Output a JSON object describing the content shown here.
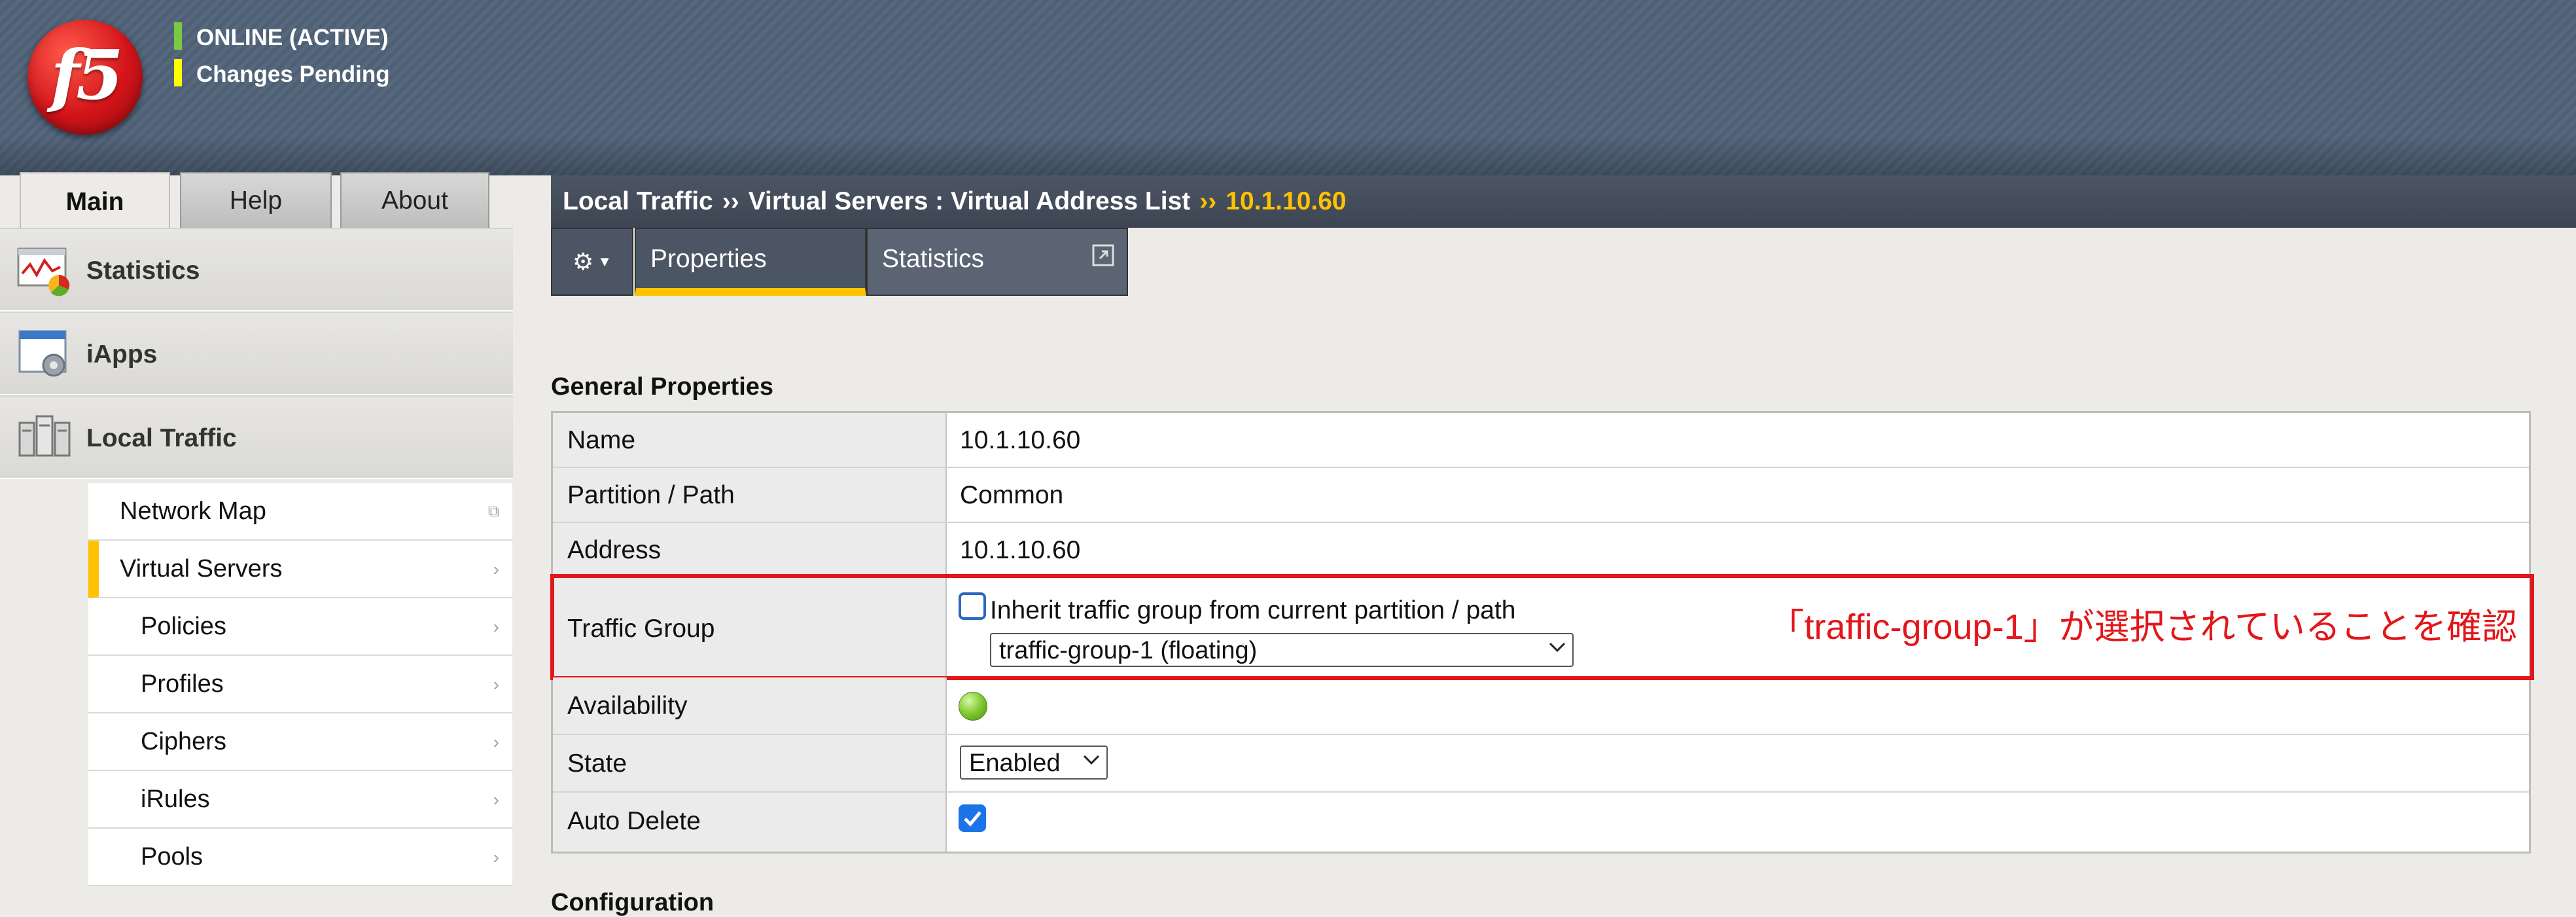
{
  "header": {
    "logo_text": "f5",
    "status_online": "ONLINE (ACTIVE)",
    "status_pending": "Changes Pending",
    "online_color": "#7ac943",
    "pending_color": "#ffff00"
  },
  "main_tabs": [
    {
      "label": "Main",
      "active": true
    },
    {
      "label": "Help",
      "active": false
    },
    {
      "label": "About",
      "active": false
    }
  ],
  "breadcrumb": {
    "part1": "Local Traffic",
    "sep": "››",
    "part2": "Virtual Servers : Virtual Address List",
    "current": "10.1.10.60"
  },
  "sidebar": {
    "sections": [
      {
        "label": "Statistics",
        "icon": "statistics-chart-icon"
      },
      {
        "label": "iApps",
        "icon": "iapps-gear-window-icon"
      },
      {
        "label": "Local Traffic",
        "icon": "local-traffic-servers-icon"
      }
    ],
    "items": [
      {
        "label": "Network Map",
        "selected": false,
        "indent": false
      },
      {
        "label": "Virtual Servers",
        "selected": true,
        "indent": false
      },
      {
        "label": "Policies",
        "selected": false,
        "indent": true
      },
      {
        "label": "Profiles",
        "selected": false,
        "indent": true
      },
      {
        "label": "Ciphers",
        "selected": false,
        "indent": true
      },
      {
        "label": "iRules",
        "selected": false,
        "indent": true
      },
      {
        "label": "Pools",
        "selected": false,
        "indent": true
      }
    ]
  },
  "subtabs": {
    "properties": "Properties",
    "statistics": "Statistics"
  },
  "general": {
    "title": "General Properties",
    "name_label": "Name",
    "name_value": "10.1.10.60",
    "partition_label": "Partition / Path",
    "partition_value": "Common",
    "address_label": "Address",
    "address_value": "10.1.10.60",
    "traffic_label": "Traffic Group",
    "inherit_text": "Inherit traffic group from current partition / path",
    "inherit_checked": false,
    "traffic_group_selected": "traffic-group-1 (floating)",
    "availability_label": "Availability",
    "availability_status": "green",
    "state_label": "State",
    "state_selected": "Enabled",
    "auto_delete_label": "Auto Delete",
    "auto_delete_checked": true
  },
  "annotation": {
    "text": "「traffic-group-1」が選択されていることを確認",
    "color": "#e3161a"
  },
  "next_section": "Configuration"
}
